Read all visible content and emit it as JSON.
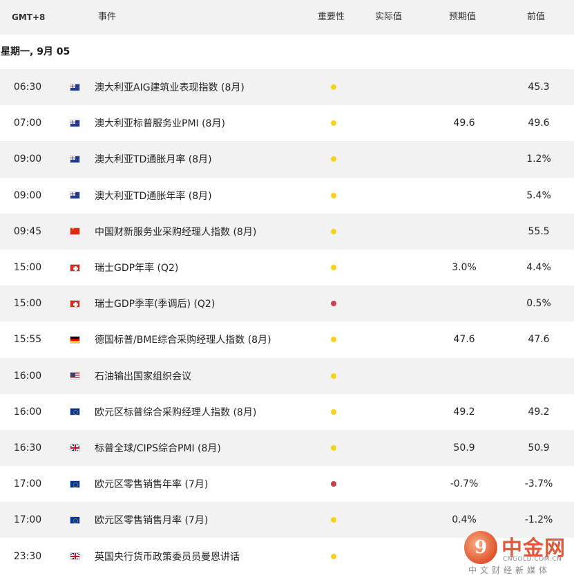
{
  "header": {
    "timezone": "GMT+8",
    "event": "事件",
    "importance": "重要性",
    "actual": "实际值",
    "forecast": "预期值",
    "previous": "前值"
  },
  "day_label": "星期一, 9月 05",
  "colors": {
    "yellow_dot": "#f5d21c",
    "red_dot": "#c8414f",
    "row_shade": "#f2f2f2"
  },
  "rows": [
    {
      "time": "06:30",
      "flag": "australia-flag-icon",
      "event": "澳大利亚AIG建筑业表现指数 (8月)",
      "importance": "yellow",
      "forecast": "",
      "previous": "45.3"
    },
    {
      "time": "07:00",
      "flag": "australia-flag-icon",
      "event": "澳大利亚标普服务业PMI (8月)",
      "importance": "yellow",
      "forecast": "49.6",
      "previous": "49.6"
    },
    {
      "time": "09:00",
      "flag": "australia-flag-icon",
      "event": "澳大利亚TD通胀月率 (8月)",
      "importance": "yellow",
      "forecast": "",
      "previous": "1.2%"
    },
    {
      "time": "09:00",
      "flag": "australia-flag-icon",
      "event": "澳大利亚TD通胀年率 (8月)",
      "importance": "yellow",
      "forecast": "",
      "previous": "5.4%"
    },
    {
      "time": "09:45",
      "flag": "china-flag-icon",
      "event": "中国财新服务业采购经理人指数 (8月)",
      "importance": "yellow",
      "forecast": "",
      "previous": "55.5"
    },
    {
      "time": "15:00",
      "flag": "switzerland-flag-icon",
      "event": "瑞士GDP年率 (Q2)",
      "importance": "yellow",
      "forecast": "3.0%",
      "previous": "4.4%"
    },
    {
      "time": "15:00",
      "flag": "switzerland-flag-icon",
      "event": "瑞士GDP季率(季调后) (Q2)",
      "importance": "red",
      "forecast": "",
      "previous": "0.5%"
    },
    {
      "time": "15:55",
      "flag": "germany-flag-icon",
      "event": "德国标普/BME综合采购经理人指数 (8月)",
      "importance": "yellow",
      "forecast": "47.6",
      "previous": "47.6"
    },
    {
      "time": "16:00",
      "flag": "usa-flag-icon",
      "event": "石油输出国家组织会议",
      "importance": "yellow",
      "forecast": "",
      "previous": ""
    },
    {
      "time": "16:00",
      "flag": "eu-flag-icon",
      "event": "欧元区标普综合采购经理人指数 (8月)",
      "importance": "yellow",
      "forecast": "49.2",
      "previous": "49.2"
    },
    {
      "time": "16:30",
      "flag": "uk-flag-icon",
      "event": "标普全球/CIPS综合PMI (8月)",
      "importance": "yellow",
      "forecast": "50.9",
      "previous": "50.9"
    },
    {
      "time": "17:00",
      "flag": "eu-flag-icon",
      "event": "欧元区零售销售年率 (7月)",
      "importance": "red",
      "forecast": "-0.7%",
      "previous": "-3.7%"
    },
    {
      "time": "17:00",
      "flag": "eu-flag-icon",
      "event": "欧元区零售销售月率 (7月)",
      "importance": "yellow",
      "forecast": "0.4%",
      "previous": "-1.2%"
    },
    {
      "time": "23:30",
      "flag": "uk-flag-icon",
      "event": "英国央行货币政策委员员曼恩讲话",
      "importance": "yellow",
      "forecast": "",
      "previous": ""
    }
  ],
  "watermark": {
    "title": "中金网",
    "url": "CNGOLD.COM.CN",
    "subtitle": "中文财经新媒体"
  }
}
